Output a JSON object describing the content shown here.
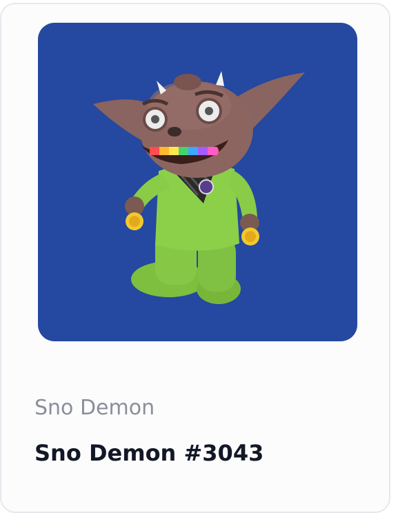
{
  "card": {
    "collection_name": "Sno Demon",
    "item_name": "Sno Demon #3043"
  },
  "artwork": {
    "background_color": "#2548a0",
    "subject": "creature-figure"
  }
}
